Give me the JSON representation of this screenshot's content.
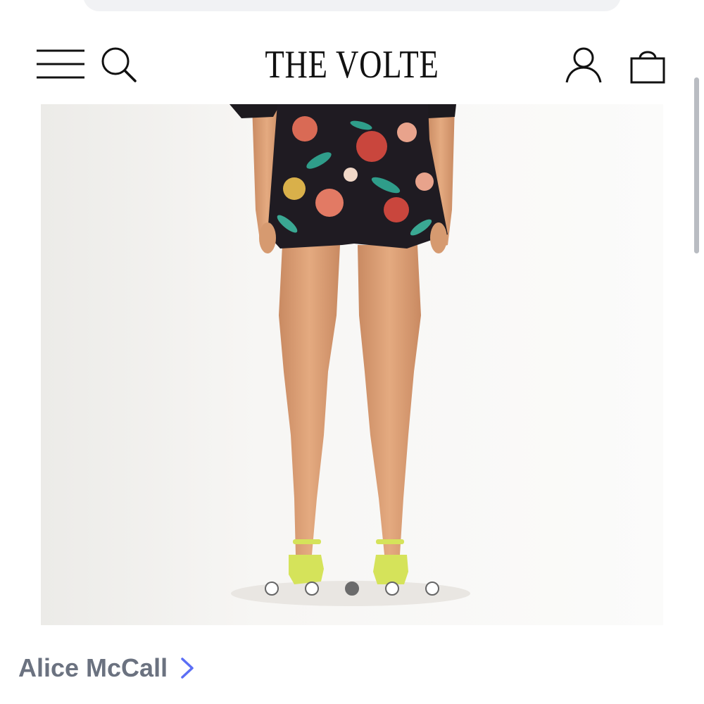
{
  "header": {
    "logo": "THE VOLTE",
    "icons": [
      "menu-icon",
      "search-icon",
      "account-icon",
      "bag-icon"
    ]
  },
  "gallery": {
    "slide_count": 5,
    "active_slide": 3
  },
  "brand": {
    "name": "Alice McCall",
    "link_color": "#6b7280",
    "chevron_color": "#5b6ef5"
  }
}
